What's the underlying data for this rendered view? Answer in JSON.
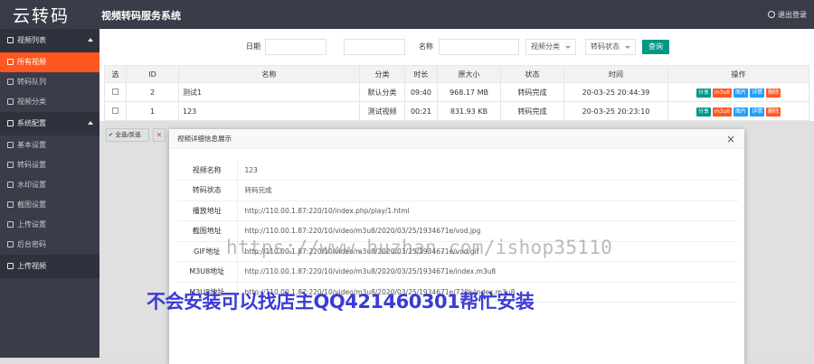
{
  "header": {
    "logo": "云转码",
    "title": "视频转码服务系统",
    "logout": "退出登录"
  },
  "sidebar": {
    "groups": [
      {
        "label": "视频列表",
        "items": [
          {
            "label": "所有视频",
            "active": true
          },
          {
            "label": "转码队列",
            "active": false
          },
          {
            "label": "视频分类",
            "active": false
          }
        ]
      },
      {
        "label": "系统配置",
        "items": [
          {
            "label": "基本设置"
          },
          {
            "label": "转码设置"
          },
          {
            "label": "水印设置"
          },
          {
            "label": "截图设置"
          },
          {
            "label": "上传设置"
          },
          {
            "label": "后台密码"
          }
        ]
      }
    ],
    "upload": "上传视频"
  },
  "filter": {
    "date_label": "日期",
    "name_label": "名称",
    "category_select": "视频分类",
    "status_select": "转码状态",
    "query_button": "查询"
  },
  "table": {
    "headers": [
      "选",
      "ID",
      "名称",
      "分类",
      "时长",
      "原大小",
      "状态",
      "时间",
      "操作"
    ],
    "rows": [
      {
        "id": "2",
        "name": "测试1",
        "category": "默认分类",
        "duration": "09:40",
        "size": "968.17 MB",
        "status": "转码完成",
        "time": "20-03-25 20:44:39"
      },
      {
        "id": "1",
        "name": "123",
        "category": "测试视频",
        "duration": "00:21",
        "size": "831.93 KB",
        "status": "转码完成",
        "time": "20-03-25 20:23:10"
      }
    ],
    "actions": [
      "分享",
      "m3u8",
      "图片",
      "详情",
      "删除"
    ]
  },
  "bulk": {
    "select_all": "全选/反选",
    "delete_icon": "x-icon"
  },
  "modal": {
    "title": "视频详细信息展示",
    "close": "×",
    "rows": [
      {
        "key": "视频名称",
        "value": "123"
      },
      {
        "key": "转码状态",
        "value": "转码完成",
        "status": true
      },
      {
        "key": "播放地址",
        "value": "http://110.00.1.87:220/10/index.php/play/1.html"
      },
      {
        "key": "截图地址",
        "value": "http://110.00.1.87:220/10/video/m3u8/2020/03/25/1934671e/vod.jpg"
      },
      {
        "key": "GIF地址",
        "value": "http://110.00.1.87:220/10/video/m3u8/2020/03/25/1934671e/vod.gif"
      },
      {
        "key": "M3U8地址",
        "value": "http://110.00.1.87:220/10/video/m3u8/2020/03/25/1934671e/index.m3u8"
      },
      {
        "key": "M3U8地址",
        "value": "http://110.00.1.87:220/10/video/m3u8/2020/03/25/1934671e/720k/index.m3u8"
      }
    ]
  },
  "watermark": "https://www.huzhan.com/ishop35110",
  "advert": "不会安装可以找店主QQ421460301帮忙安装",
  "colors": {
    "header": "#393d49",
    "active": "#ff5722",
    "primary": "#009688",
    "link_blue": "#1e9fff",
    "ad_text": "#3b3bd6"
  }
}
